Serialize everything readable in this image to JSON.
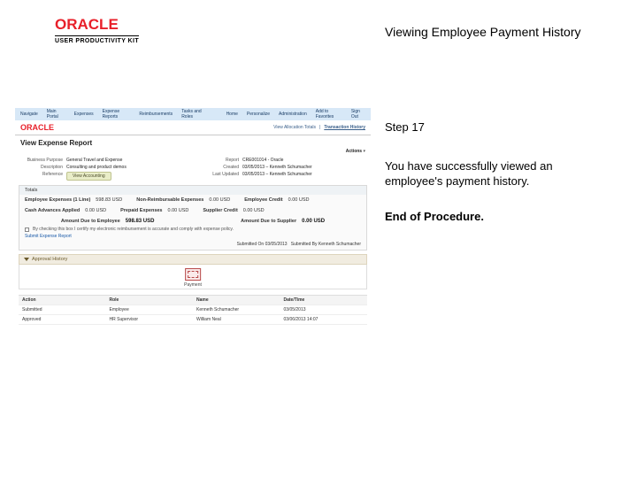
{
  "brand": {
    "logo": "ORACLE",
    "sub": "USER PRODUCTIVITY KIT"
  },
  "title": "Viewing Employee Payment History",
  "instructions": {
    "step": "Step 17",
    "body": "You have successfully viewed an employee's payment history.",
    "end": "End of Procedure."
  },
  "app": {
    "topbar": {
      "items": [
        "Navigate",
        "Main Portal",
        "Expenses",
        "Expense Reports",
        "Reimbursements",
        "Tasks and Roles"
      ],
      "right": [
        "Home",
        "Personalize",
        "Administration",
        "Add to Favorites"
      ],
      "signout": "Sign Out"
    },
    "oracle_logo": "ORACLE",
    "view_links": {
      "a": "View Allocation Totals",
      "b": "Transaction History"
    },
    "crumb": "View Expense Report",
    "actions_label": "Actions",
    "details": {
      "l1a_lab": "Business Purpose",
      "l1a_val": "General Travel and Expense",
      "l1b_lab": "Report",
      "l1b_val": "CRE001014 - Oracle",
      "l2a_lab": "Description",
      "l2a_val": "Consulting and product demos",
      "l2b_lab": "Created",
      "l2b_val": "03/05/2013 – Kenneth Schumacher",
      "l3a_lab": "Reference",
      "l3a_val": "",
      "l3b_lab": "Last Updated",
      "l3b_val": "03/05/2013 – Kenneth Schumacher",
      "view_accounting": "View Accounting"
    },
    "totals": {
      "header": "Totals",
      "r1a_l": "Employee Expenses (1 Line)",
      "r1a_v": "598.83 USD",
      "r1b_l": "Non-Reimbursable Expenses",
      "r1b_v": "0.00 USD",
      "r1c_l": "Employee Credit",
      "r1c_v": "0.00 USD",
      "r2a_l": "Cash Advances Applied",
      "r2a_v": "0.00 USD",
      "r2b_l": "Prepaid Expenses",
      "r2b_v": "0.00 USD",
      "r2c_l": "Supplier Credit",
      "r2c_v": "0.00 USD",
      "due_emp_l": "Amount Due to Employee",
      "due_emp_v": "598.83  USD",
      "due_sup_l": "Amount Due to Supplier",
      "due_sup_v": "0.00  USD",
      "cert": "By checking this box I certify my electronic reimbursement is accurate and comply with expense policy.",
      "attach": "Submit Expense Report",
      "subm_l": "Submitted On",
      "subm_v": "03/05/2013",
      "submby_l": "Submitted By",
      "submby_v": "Kenneth Schumacher"
    },
    "accordion": {
      "title": "Approval History"
    },
    "payment": {
      "caption": "Payment"
    },
    "table": {
      "headers": [
        "Action",
        "Role",
        "Name",
        "Date/Time"
      ],
      "rows": [
        [
          "Submitted",
          "Employee",
          "Kenneth Schumacher",
          "03/05/2013"
        ],
        [
          "Approved",
          "HR Supervisor",
          "William Neal",
          "03/06/2013 14:07"
        ]
      ]
    }
  }
}
